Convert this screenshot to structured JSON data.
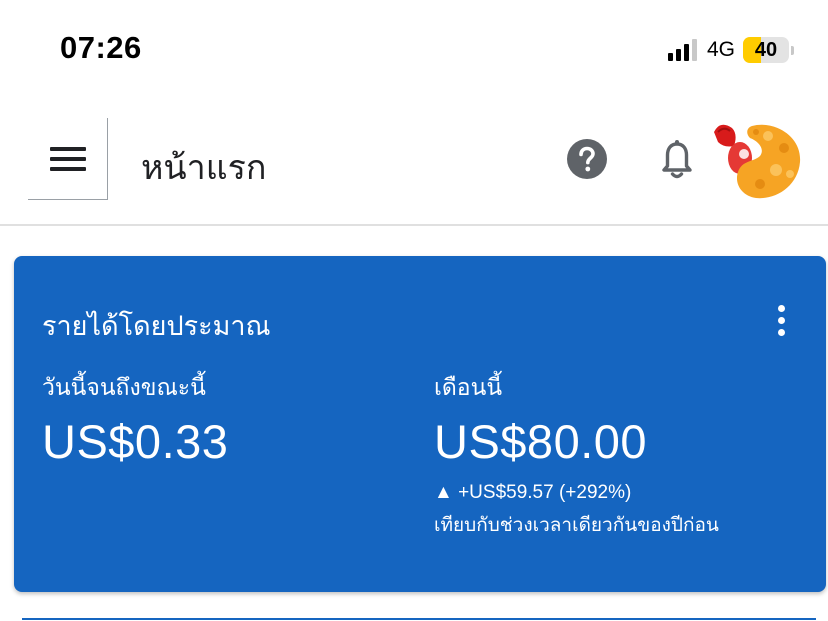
{
  "status_bar": {
    "time": "07:26",
    "network": "4G",
    "battery_level": "40",
    "battery_fraction": 0.4,
    "signal_bars_filled": 3,
    "signal_bars_total": 4
  },
  "appbar": {
    "title": "หน้าแรก",
    "icons": [
      "menu-icon",
      "help-icon",
      "notifications-bell-icon",
      "avatar-shrimp"
    ]
  },
  "earnings_card": {
    "title": "รายได้โดยประมาณ",
    "today": {
      "label": "วันนี้จนถึงขณะนี้",
      "value": "US$0.33"
    },
    "this_month": {
      "label": "เดือนนี้",
      "value": "US$80.00",
      "change": "▲ +US$59.57 (+292%)",
      "comparison": "เทียบกับช่วงเวลาเดียวกันของปีก่อน"
    }
  },
  "colors": {
    "card_background": "#1565c0",
    "battery_fill": "#ffcc00",
    "icon_gray": "#5f6368"
  }
}
